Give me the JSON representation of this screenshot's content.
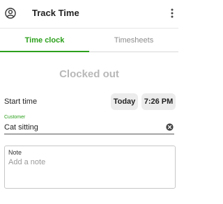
{
  "header": {
    "title": "Track Time",
    "account_icon": "account-circle-icon",
    "more_icon": "more-vertical-icon"
  },
  "tabs": [
    {
      "label": "Time clock",
      "active": true
    },
    {
      "label": "Timesheets",
      "active": false
    }
  ],
  "status": {
    "text": "Clocked out"
  },
  "start_time": {
    "label": "Start time",
    "day": "Today",
    "time": "7:26 PM"
  },
  "customer": {
    "label": "Customer",
    "value": "Cat sitting",
    "clear_icon": "clear-circle-icon"
  },
  "note": {
    "label": "Note",
    "placeholder": "Add a note"
  },
  "colors": {
    "accent": "#2ca01c",
    "muted_text": "#b8b8b8",
    "pill_bg": "#ececec"
  }
}
